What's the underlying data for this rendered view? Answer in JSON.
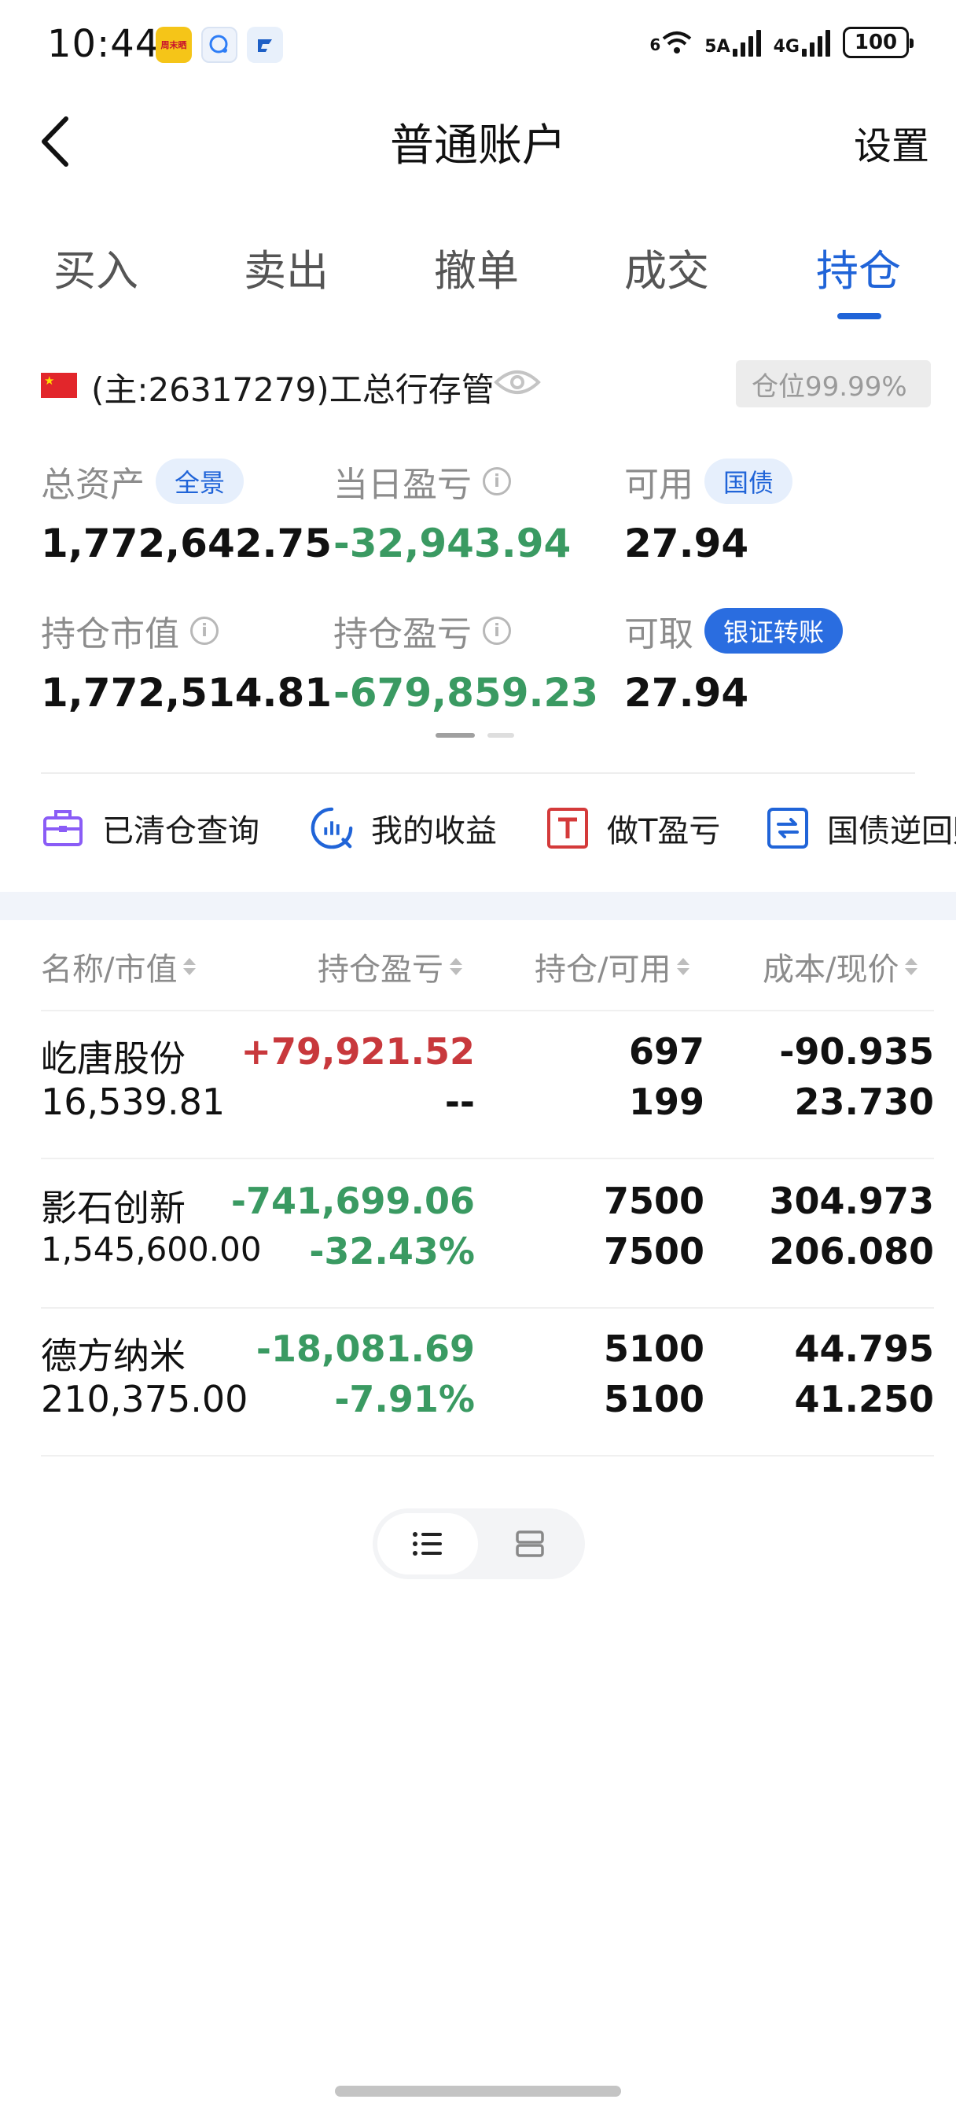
{
  "status_bar": {
    "time": "10:44",
    "app_icons": [
      "周末晒",
      "信息",
      "广发证券"
    ],
    "network_labels": [
      "6",
      "5A",
      "4G"
    ],
    "battery": "100"
  },
  "header": {
    "title": "普通账户",
    "settings_label": "设置"
  },
  "tabs": [
    {
      "label": "买入",
      "active": false
    },
    {
      "label": "卖出",
      "active": false
    },
    {
      "label": "撤单",
      "active": false
    },
    {
      "label": "成交",
      "active": false
    },
    {
      "label": "持仓",
      "active": true
    }
  ],
  "account": {
    "label": "(主:26317279)工总行存管",
    "position_ratio": "仓位99.99%"
  },
  "summary": {
    "total_assets": {
      "label": "总资产",
      "badge": "全景",
      "value": "1,772,642.75"
    },
    "daily_pnl": {
      "label": "当日盈亏",
      "value": "-32,943.94"
    },
    "available": {
      "label": "可用",
      "badge": "国债",
      "value": "27.94"
    },
    "market_value": {
      "label": "持仓市值",
      "value": "1,772,514.81"
    },
    "position_pnl": {
      "label": "持仓盈亏",
      "value": "-679,859.23"
    },
    "withdrawable": {
      "label": "可取",
      "badge": "银证转账",
      "value": "27.94"
    }
  },
  "quick_actions": [
    {
      "label": "已清仓查询",
      "icon": "briefcase-icon"
    },
    {
      "label": "我的收益",
      "icon": "chart-circle-icon"
    },
    {
      "label": "做T盈亏",
      "icon": "t-box-icon"
    },
    {
      "label": "国债逆回购",
      "icon": "repo-icon"
    }
  ],
  "table": {
    "headers": [
      "名称/市值",
      "持仓盈亏",
      "持仓/可用",
      "成本/现价"
    ],
    "rows": [
      {
        "name": "屹唐股份",
        "market_value": "16,539.81",
        "pnl": "+79,921.52",
        "pnl_pct": "--",
        "qty": "697",
        "available": "199",
        "cost": "-90.935",
        "price": "23.730",
        "pnl_color": "red",
        "pct_color": "black"
      },
      {
        "name": "影石创新",
        "market_value": "1,545,600.00",
        "pnl": "-741,699.06",
        "pnl_pct": "-32.43%",
        "qty": "7500",
        "available": "7500",
        "cost": "304.973",
        "price": "206.080",
        "pnl_color": "green",
        "pct_color": "green"
      },
      {
        "name": "德方纳米",
        "market_value": "210,375.00",
        "pnl": "-18,081.69",
        "pnl_pct": "-7.91%",
        "qty": "5100",
        "available": "5100",
        "cost": "44.795",
        "price": "41.250",
        "pnl_color": "green",
        "pct_color": "green"
      }
    ]
  },
  "colors": {
    "accent": "#2064d8",
    "profit": "#c8383c",
    "loss": "#3a9a62"
  }
}
